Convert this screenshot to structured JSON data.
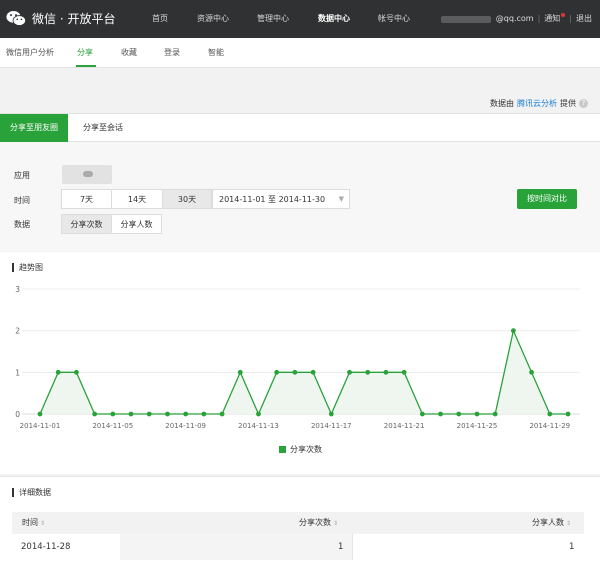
{
  "topbar": {
    "brand": "微信 · 开放平台",
    "nav": [
      {
        "label": "首页"
      },
      {
        "label": "资源中心"
      },
      {
        "label": "管理中心"
      },
      {
        "label": "数据中心"
      },
      {
        "label": "帐号中心"
      }
    ],
    "active_index": 3,
    "user_email": "@qq.com",
    "notice": "通知",
    "logout": "退出"
  },
  "subnav": {
    "items": [
      {
        "label": "微信用户分析"
      },
      {
        "label": "分享"
      },
      {
        "label": "收藏"
      },
      {
        "label": "登录"
      },
      {
        "label": "智能"
      }
    ],
    "active_index": 1
  },
  "source": {
    "prefix": "数据由",
    "link": "腾讯云分析",
    "suffix": "提供"
  },
  "tabs": [
    {
      "label": "分享至朋友圈"
    },
    {
      "label": "分享至会话"
    }
  ],
  "filters": {
    "app_label": "应用",
    "time_label": "时间",
    "data_label": "数据",
    "ranges": [
      {
        "label": "7天"
      },
      {
        "label": "14天"
      },
      {
        "label": "30天"
      }
    ],
    "selected_range": 2,
    "date_range": "2014-11-01 至 2014-11-30",
    "metrics": [
      {
        "label": "分享次数"
      },
      {
        "label": "分享人数"
      }
    ],
    "selected_metric": 0,
    "compare_button": "按时间对比"
  },
  "trend": {
    "title": "趋势图"
  },
  "chart_data": {
    "type": "area",
    "x": [
      "2014-11-01",
      "2014-11-02",
      "2014-11-03",
      "2014-11-04",
      "2014-11-05",
      "2014-11-06",
      "2014-11-07",
      "2014-11-08",
      "2014-11-09",
      "2014-11-10",
      "2014-11-11",
      "2014-11-12",
      "2014-11-13",
      "2014-11-14",
      "2014-11-15",
      "2014-11-16",
      "2014-11-17",
      "2014-11-18",
      "2014-11-19",
      "2014-11-20",
      "2014-11-21",
      "2014-11-22",
      "2014-11-23",
      "2014-11-24",
      "2014-11-25",
      "2014-11-26",
      "2014-11-27",
      "2014-11-28",
      "2014-11-29",
      "2014-11-30"
    ],
    "x_tick_labels": [
      "2014-11-01",
      "2014-11-05",
      "2014-11-09",
      "2014-11-13",
      "2014-11-17",
      "2014-11-21",
      "2014-11-25",
      "2014-11-29"
    ],
    "series": [
      {
        "name": "分享次数",
        "color": "#2aa23a",
        "values": [
          0,
          1,
          1,
          0,
          0,
          0,
          0,
          0,
          0,
          0,
          0,
          1,
          0,
          1,
          1,
          1,
          0,
          1,
          1,
          1,
          1,
          0,
          0,
          0,
          0,
          0,
          2,
          1,
          0,
          0
        ]
      }
    ],
    "ylim": [
      0,
      3
    ],
    "y_ticks": [
      0,
      1,
      2,
      3
    ],
    "legend": "bottom"
  },
  "detail": {
    "title": "详细数据",
    "columns": [
      {
        "label": "时间"
      },
      {
        "label": "分享次数"
      },
      {
        "label": "分享人数"
      }
    ],
    "rows": [
      {
        "date": "2014-11-28",
        "count": "1",
        "users": "1"
      }
    ]
  }
}
